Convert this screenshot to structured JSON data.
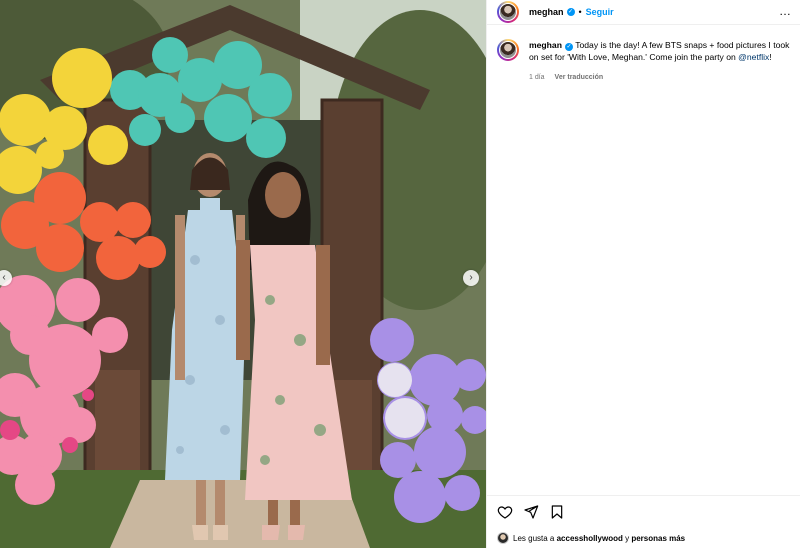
{
  "post": {
    "username": "meghan",
    "separator": "•",
    "follow_label": "Seguir",
    "more_label": "…"
  },
  "caption": {
    "username": "meghan",
    "text": "Today is the day! A few BTS snaps + food pictures I took on set for 'With Love, Meghan.' Come join the party on",
    "mention": "@netflix",
    "text_end": "!",
    "time": "1 día",
    "translate_label": "Ver traducción"
  },
  "likes": {
    "prefix": "Les gusta a",
    "liker": "accesshollywood",
    "connector": "y",
    "others": "personas más"
  },
  "icons": {
    "like": "heart-icon",
    "share": "send-icon",
    "save": "bookmark-icon",
    "prev": "chevron-left-icon",
    "next": "chevron-right-icon",
    "verified": "verified-badge-icon"
  },
  "colors": {
    "accent": "#0095f6",
    "mention": "#00376b",
    "muted": "#737373"
  }
}
